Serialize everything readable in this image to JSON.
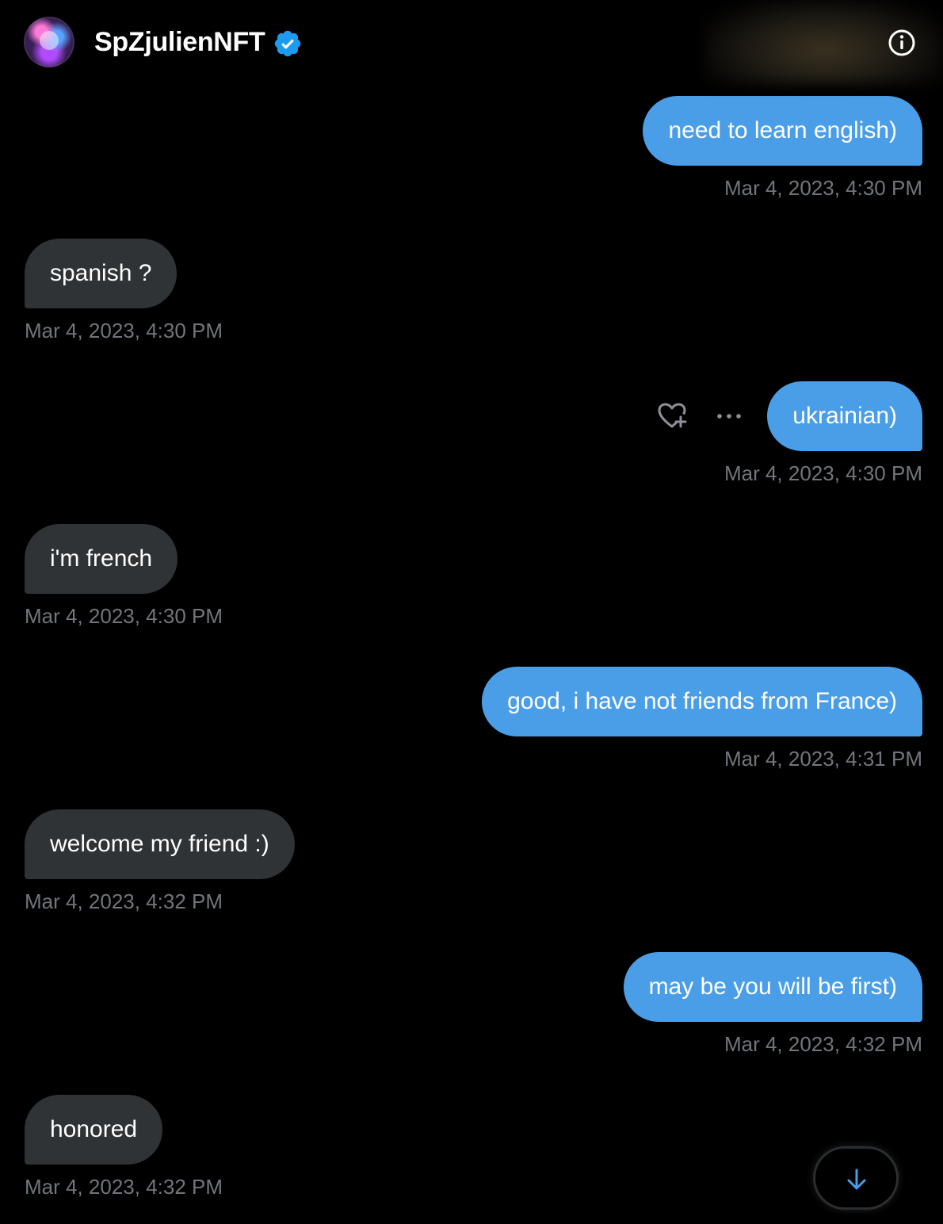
{
  "header": {
    "username": "SpZjulienNFT",
    "verified": true,
    "info_icon": "info-icon"
  },
  "colors": {
    "background": "#000000",
    "outgoing_bubble": "#4a9ee8",
    "incoming_bubble": "#2f3336",
    "timestamp": "#71767b",
    "verified_badge": "#1d9bf0"
  },
  "messages": [
    {
      "direction": "outgoing",
      "text": "need to learn english)",
      "timestamp": "Mar 4, 2023, 4:30 PM"
    },
    {
      "direction": "incoming",
      "text": "spanish ?",
      "timestamp": "Mar 4, 2023, 4:30 PM"
    },
    {
      "direction": "outgoing",
      "text": "ukrainian)",
      "timestamp": "Mar 4, 2023, 4:30 PM",
      "actions": [
        "react-heart-icon",
        "more-options-icon"
      ]
    },
    {
      "direction": "incoming",
      "text": "i'm french",
      "timestamp": "Mar 4, 2023, 4:30 PM"
    },
    {
      "direction": "outgoing",
      "text": "good, i have not friends from France)",
      "timestamp": "Mar 4, 2023, 4:31 PM"
    },
    {
      "direction": "incoming",
      "text": "welcome my friend :)",
      "timestamp": "Mar 4, 2023, 4:32 PM"
    },
    {
      "direction": "outgoing",
      "text": "may be you will be first)",
      "timestamp": "Mar 4, 2023, 4:32 PM"
    },
    {
      "direction": "incoming",
      "text": "honored",
      "timestamp": "Mar 4, 2023, 4:32 PM"
    }
  ],
  "scroll_button": {
    "icon": "arrow-down-icon"
  }
}
